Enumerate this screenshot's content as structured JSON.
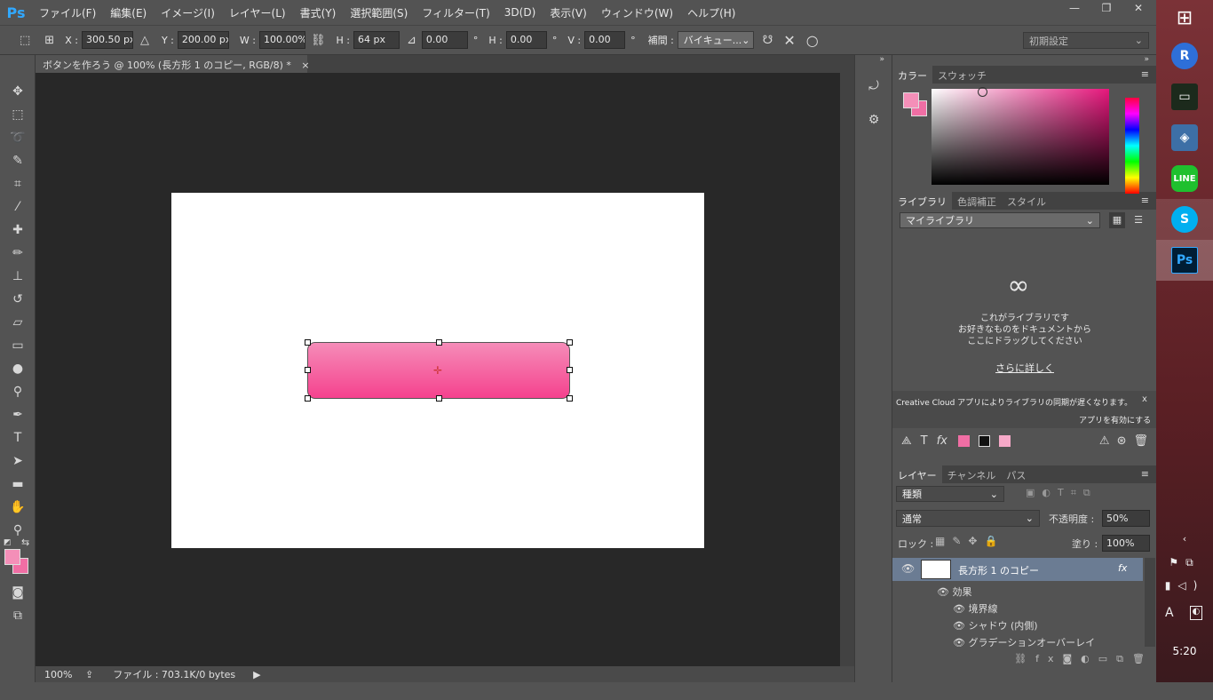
{
  "app": {
    "logo": "Ps"
  },
  "menu": [
    "ファイル(F)",
    "編集(E)",
    "イメージ(I)",
    "レイヤー(L)",
    "書式(Y)",
    "選択範囲(S)",
    "フィルター(T)",
    "3D(D)",
    "表示(V)",
    "ウィンドウ(W)",
    "ヘルプ(H)"
  ],
  "window_controls": {
    "minimize": "—",
    "restore": "❐",
    "close": "✕"
  },
  "options": {
    "x_label": "X :",
    "x_value": "300.50 px",
    "y_label": "Y :",
    "y_value": "200.00 px",
    "w_label": "W :",
    "w_value": "100.00%",
    "h_label": "H :",
    "h_value": "64 px",
    "angle_value": "0.00",
    "angle_unit": "°",
    "hskew_label": "H :",
    "hskew_value": "0.00",
    "hskew_unit": "°",
    "vskew_label": "V :",
    "vskew_value": "0.00",
    "vskew_unit": "°",
    "interp_label": "補間 :",
    "interp_value": "バイキュー...",
    "workspace": "初期設定"
  },
  "document": {
    "tab_title": "ボタンを作ろう @ 100% (長方形 1 のコピー, RGB/8) *",
    "tab_close": "×"
  },
  "status": {
    "zoom": "100%",
    "file": "ファイル : 703.1K/0 bytes"
  },
  "color_panel": {
    "tabs": [
      "カラー",
      "スウォッチ"
    ],
    "fg": "#f48fb8",
    "bg": "#f06ea4"
  },
  "library_panel": {
    "tabs": [
      "ライブラリ",
      "色調補正",
      "スタイル"
    ],
    "select": "マイライブラリ",
    "message_lines": [
      "これがライブラリです",
      "お好きなものをドキュメントから",
      "ここにドラッグしてください"
    ],
    "more_link": "さらに詳しく",
    "cc_notice": "Creative Cloud アプリによりライブラリの同期が遅くなります。",
    "cc_close": "x",
    "cc_enable": "アプリを有効にする",
    "swatch_colors": [
      "#f06ea4",
      "#111111",
      "#f6a9c8"
    ]
  },
  "layers_panel": {
    "tabs": [
      "レイヤー",
      "チャンネル",
      "パス"
    ],
    "filter": "種類",
    "blend": "通常",
    "opacity_label": "不透明度 :",
    "opacity_value": "50%",
    "lock_label": "ロック :",
    "fill_label": "塗り :",
    "fill_value": "100%",
    "layer_name": "長方形 1 のコピー",
    "fx": "fx",
    "effects_label": "効果",
    "effects": [
      "境界線",
      "シャドウ (内側)",
      "グラデーションオーバーレイ"
    ]
  },
  "taskbar": {
    "clock": "5:20",
    "ime": "A"
  }
}
